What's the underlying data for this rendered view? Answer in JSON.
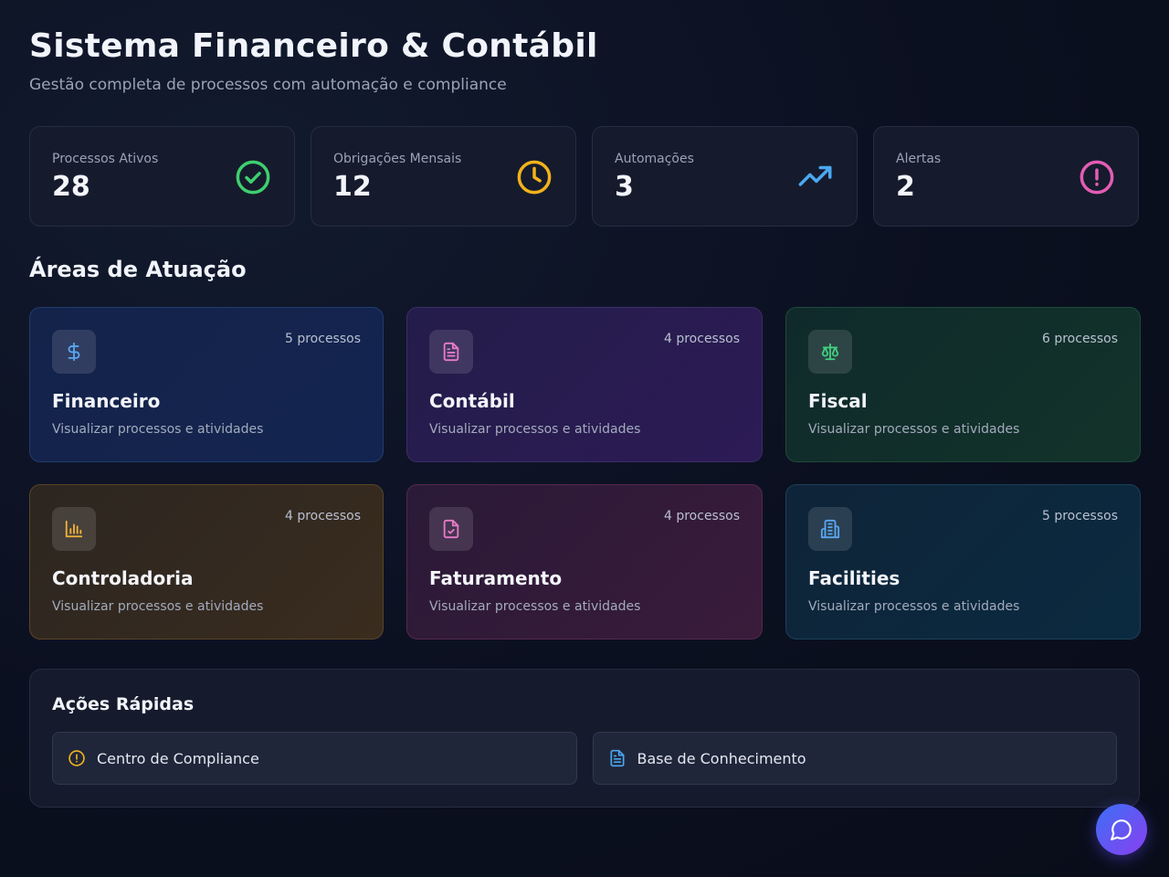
{
  "header": {
    "title": "Sistema Financeiro & Contábil",
    "subtitle": "Gestão completa de processos com automação e compliance"
  },
  "stats": [
    {
      "label": "Processos Ativos",
      "value": "28",
      "icon": "check-circle-icon",
      "color": "#3ecf6e"
    },
    {
      "label": "Obrigações Mensais",
      "value": "12",
      "icon": "clock-icon",
      "color": "#f2b21b"
    },
    {
      "label": "Automações",
      "value": "3",
      "icon": "trending-up-icon",
      "color": "#4aa8f0"
    },
    {
      "label": "Alertas",
      "value": "2",
      "icon": "alert-circle-icon",
      "color": "#e45cb4"
    }
  ],
  "areas_title": "Áreas de Atuação",
  "areas": [
    {
      "title": "Financeiro",
      "count": "5 processos",
      "desc": "Visualizar processos e atividades",
      "icon": "dollar-icon",
      "color": "#5aa6f0"
    },
    {
      "title": "Contábil",
      "count": "4 processos",
      "desc": "Visualizar processos e atividades",
      "icon": "document-icon",
      "color": "#e77ac8"
    },
    {
      "title": "Fiscal",
      "count": "6 processos",
      "desc": "Visualizar processos e atividades",
      "icon": "scale-icon",
      "color": "#3fcf7f"
    },
    {
      "title": "Controladoria",
      "count": "4 processos",
      "desc": "Visualizar processos e atividades",
      "icon": "bar-chart-icon",
      "color": "#f0b43a"
    },
    {
      "title": "Faturamento",
      "count": "4 processos",
      "desc": "Visualizar processos e atividades",
      "icon": "file-check-icon",
      "color": "#e77ac8"
    },
    {
      "title": "Facilities",
      "count": "5 processos",
      "desc": "Visualizar processos e atividades",
      "icon": "building-icon",
      "color": "#5aa6f0"
    }
  ],
  "quick_actions": {
    "title": "Ações Rápidas",
    "items": [
      {
        "label": "Centro de Compliance",
        "icon": "alert-circle-icon",
        "color": "#f2b21b"
      },
      {
        "label": "Base de Conhecimento",
        "icon": "document-icon",
        "color": "#4aa8f0"
      }
    ]
  },
  "chat": {
    "icon": "chat-bubble-icon"
  }
}
